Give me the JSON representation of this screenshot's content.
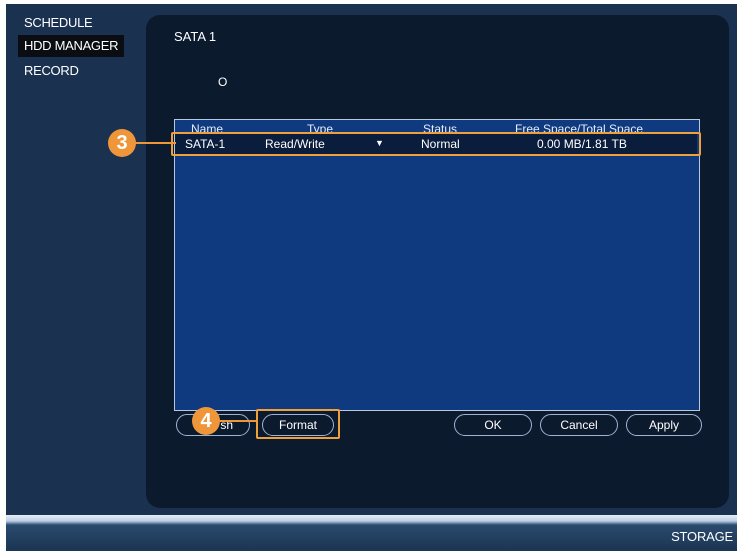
{
  "sidebar": {
    "items": [
      {
        "label": "SCHEDULE",
        "active": false
      },
      {
        "label": "HDD MANAGER",
        "active": true
      },
      {
        "label": "RECORD",
        "active": false
      }
    ]
  },
  "panel": {
    "disk_title": "SATA 1",
    "radio_label": "O"
  },
  "table": {
    "headers": {
      "name": "Name",
      "type": "Type",
      "status": "Status",
      "space": "Free Space/Total Space"
    },
    "rows": [
      {
        "name": "SATA-1",
        "type": "Read/Write",
        "status": "Normal",
        "space": "0.00 MB/1.81 TB"
      }
    ]
  },
  "buttons": {
    "refresh_partial": "sh",
    "format": "Format",
    "ok": "OK",
    "cancel": "Cancel",
    "apply": "Apply"
  },
  "callouts": {
    "row_marker": "3",
    "format_marker": "4"
  },
  "status_bar": {
    "label": "STORAGE"
  },
  "colors": {
    "background": "#1a3250",
    "panel": "#0c1a2e",
    "table": "#0f3a80",
    "highlight": "#f0a03a"
  }
}
